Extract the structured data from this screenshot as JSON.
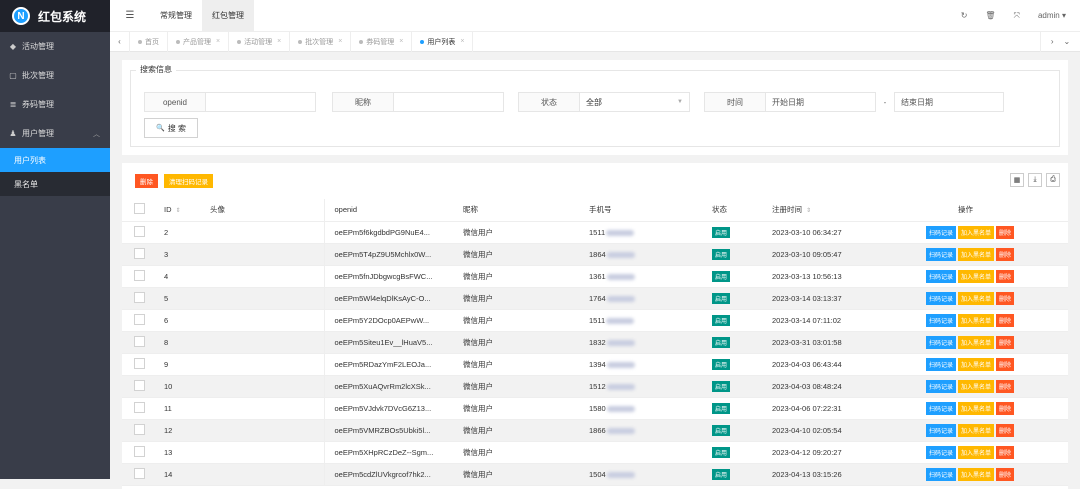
{
  "app": {
    "logo_letter": "N",
    "title": "红包系统"
  },
  "sidebar": {
    "items": [
      {
        "icon": "◆",
        "label": "活动管理"
      },
      {
        "icon": "▢",
        "label": "批次管理"
      },
      {
        "icon": "≣",
        "label": "券码管理"
      },
      {
        "icon": "♟",
        "label": "用户管理",
        "expanded": true
      }
    ],
    "submenu": [
      {
        "label": "用户列表",
        "active": true
      },
      {
        "label": "黑名单",
        "active": false
      }
    ]
  },
  "topbar": {
    "menu_icon": "☰",
    "tabs": [
      {
        "label": "常规管理",
        "active": false
      },
      {
        "label": "红包管理",
        "active": true
      }
    ],
    "refresh_icon": "↻",
    "clear_icon": "🗑",
    "fullscreen_icon": "⤧",
    "user": "admin",
    "user_caret": "▾"
  },
  "page_tabs": {
    "prev": "‹",
    "next": "›",
    "dropdown": "⌄",
    "tabs": [
      {
        "label": "首页",
        "closable": false,
        "active": false
      },
      {
        "label": "产品管理",
        "closable": true,
        "active": false
      },
      {
        "label": "活动管理",
        "closable": true,
        "active": false
      },
      {
        "label": "批次管理",
        "closable": true,
        "active": false
      },
      {
        "label": "券码管理",
        "closable": true,
        "active": false
      },
      {
        "label": "用户列表",
        "closable": true,
        "active": true
      }
    ],
    "close": "×"
  },
  "search": {
    "legend": "搜索信息",
    "openid_label": "openid",
    "openid_value": "",
    "nick_label": "昵称",
    "nick_value": "",
    "status_label": "状态",
    "status_value": "全部",
    "time_label": "时间",
    "start_placeholder": "开始日期",
    "dash": "-",
    "end_placeholder": "结束日期",
    "button": "搜 索",
    "button_icon": "🔍"
  },
  "toolbar": {
    "delete": "删除",
    "clear_scan": "清理扫码记录",
    "cols_icon": "▦",
    "export_icon": "⤓",
    "print_icon": "⎙"
  },
  "table": {
    "headers": {
      "id": "ID",
      "avatar": "头像",
      "openid": "openid",
      "nick": "昵称",
      "phone": "手机号",
      "status": "状态",
      "reg_time": "注册时间",
      "ops": "操作"
    },
    "sort_icon": "⇕",
    "op_labels": {
      "scan": "扫码记录",
      "blacklist": "加入黑名单",
      "delete": "删除"
    },
    "rows": [
      {
        "id": "2",
        "openid": "oeEPm5f6kgdbdPG9NuE4...",
        "nick": "微信用户",
        "phone_prefix": "1511",
        "status": "启用",
        "time": "2023-03-10 06:34:27"
      },
      {
        "id": "3",
        "openid": "oeEPm5T4pZ9U5Mchlx0W...",
        "nick": "微信用户",
        "phone_prefix": "1864",
        "status": "启用",
        "time": "2023-03-10 09:05:47"
      },
      {
        "id": "4",
        "openid": "oeEPm5fnJDbgwcgBsFWC...",
        "nick": "微信用户",
        "phone_prefix": "1361",
        "status": "启用",
        "time": "2023-03-13 10:56:13"
      },
      {
        "id": "5",
        "openid": "oeEPm5Wl4elqDlKsAyC-O...",
        "nick": "微信用户",
        "phone_prefix": "1764",
        "status": "启用",
        "time": "2023-03-14 03:13:37"
      },
      {
        "id": "6",
        "openid": "oeEPm5Y2DOcp0AEPwW...",
        "nick": "微信用户",
        "phone_prefix": "1511",
        "status": "启用",
        "time": "2023-03-14 07:11:02"
      },
      {
        "id": "8",
        "openid": "oeEPm5Siteu1Ev__lHuaV5...",
        "nick": "微信用户",
        "phone_prefix": "1832",
        "status": "启用",
        "time": "2023-03-31 03:01:58"
      },
      {
        "id": "9",
        "openid": "oeEPm5RDazYmF2LEOJa...",
        "nick": "微信用户",
        "phone_prefix": "1394",
        "status": "启用",
        "time": "2023-04-03 06:43:44"
      },
      {
        "id": "10",
        "openid": "oeEPm5XuAQvrRm2lcXSk...",
        "nick": "微信用户",
        "phone_prefix": "1512",
        "status": "启用",
        "time": "2023-04-03 08:48:24"
      },
      {
        "id": "11",
        "openid": "oeEPm5VJdvk7DVcG6Z13...",
        "nick": "微信用户",
        "phone_prefix": "1580",
        "status": "启用",
        "time": "2023-04-06 07:22:31"
      },
      {
        "id": "12",
        "openid": "oeEPm5VMRZBOs5Ubki5l...",
        "nick": "微信用户",
        "phone_prefix": "1866",
        "status": "启用",
        "time": "2023-04-10 02:05:54"
      },
      {
        "id": "13",
        "openid": "oeEPm5XHpRCzDeZ--Sgm...",
        "nick": "微信用户",
        "phone_prefix": "",
        "status": "启用",
        "time": "2023-04-12 09:20:27"
      },
      {
        "id": "14",
        "openid": "oeEPm5cdZlUVkgrcof7hk2...",
        "nick": "微信用户",
        "phone_prefix": "1504",
        "status": "启用",
        "time": "2023-04-13 03:15:26"
      }
    ]
  }
}
